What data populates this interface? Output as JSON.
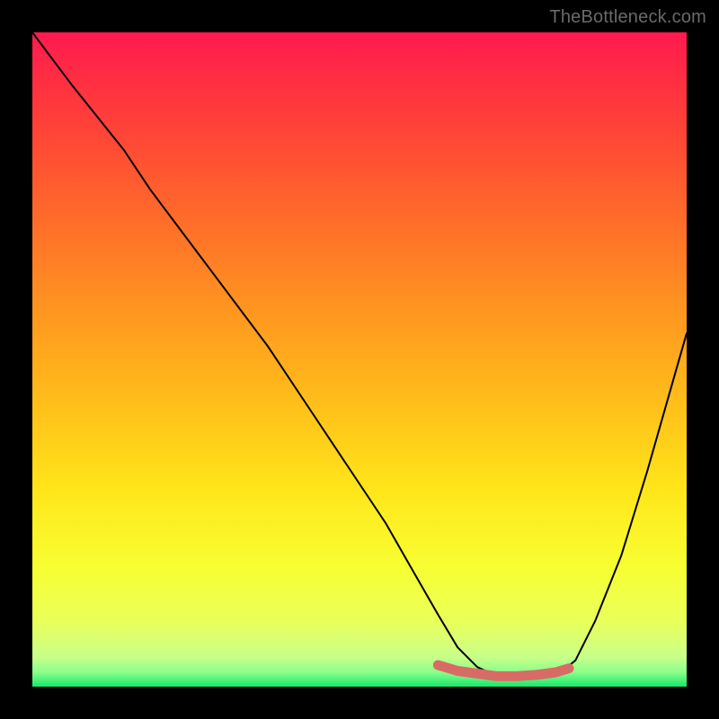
{
  "watermark": "TheBottleneck.com",
  "chart_data": {
    "type": "line",
    "title": "",
    "xlabel": "",
    "ylabel": "",
    "xlim": [
      0,
      100
    ],
    "ylim": [
      0,
      100
    ],
    "description": "Bottleneck curve over a vertical severity gradient (red=high bottleneck at top, green=no bottleneck at bottom). The black curve descends from top-left, reaches a minimum plateau, then rises toward the right edge. The coral highlight marks the sweet-spot segment near the minimum.",
    "gradient": {
      "direction": "vertical",
      "stops": [
        {
          "offset": 0.0,
          "color": "#ff1a4f"
        },
        {
          "offset": 0.12,
          "color": "#ff3b3b"
        },
        {
          "offset": 0.28,
          "color": "#ff6a2a"
        },
        {
          "offset": 0.44,
          "color": "#ff9a1f"
        },
        {
          "offset": 0.58,
          "color": "#ffc21a"
        },
        {
          "offset": 0.7,
          "color": "#ffe61a"
        },
        {
          "offset": 0.82,
          "color": "#f7ff33"
        },
        {
          "offset": 0.9,
          "color": "#eaff5a"
        },
        {
          "offset": 0.955,
          "color": "#c8ff8a"
        },
        {
          "offset": 0.978,
          "color": "#8aff8a"
        },
        {
          "offset": 1.0,
          "color": "#17e86b"
        }
      ]
    },
    "series": [
      {
        "name": "bottleneck-curve",
        "color": "#000000",
        "x": [
          0,
          3,
          6,
          10,
          14,
          18,
          24,
          30,
          36,
          42,
          48,
          54,
          58,
          62,
          65,
          68,
          71,
          74,
          77,
          80,
          83,
          86,
          90,
          94,
          98,
          100
        ],
        "y": [
          100,
          96,
          92,
          87,
          82,
          76,
          68,
          60,
          52,
          43,
          34,
          25,
          18,
          11,
          6,
          3,
          1.6,
          1.2,
          1.2,
          1.6,
          4,
          10,
          20,
          33,
          47,
          54
        ]
      }
    ],
    "highlight": {
      "name": "sweet-spot",
      "color": "#d96b66",
      "x": [
        62,
        65,
        68,
        71,
        74,
        77,
        80,
        82
      ],
      "y": [
        3.3,
        2.4,
        2.0,
        1.6,
        1.6,
        1.8,
        2.2,
        2.8
      ]
    }
  }
}
